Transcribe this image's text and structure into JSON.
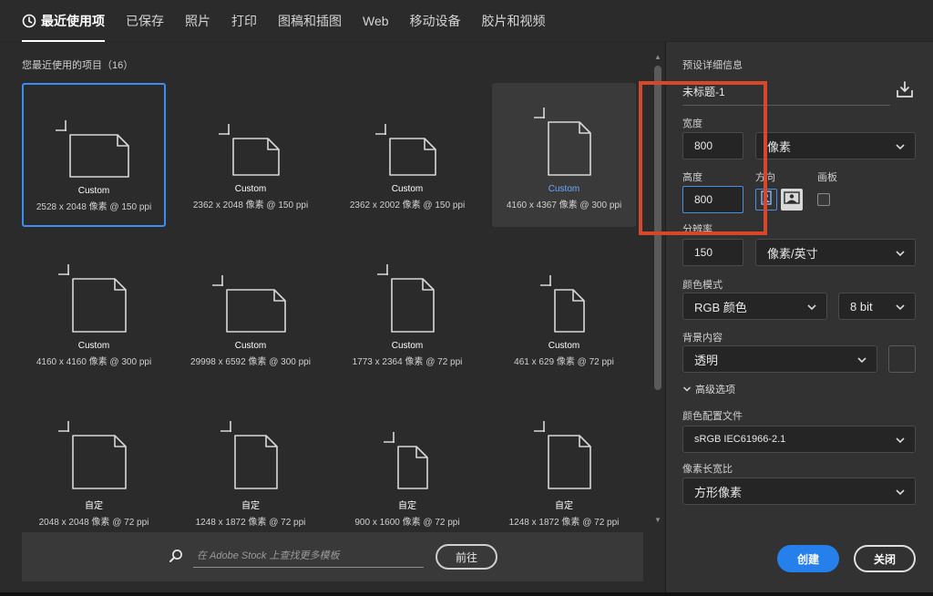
{
  "tabs": [
    {
      "label": "最近使用项",
      "active": true
    },
    {
      "label": "已保存"
    },
    {
      "label": "照片"
    },
    {
      "label": "打印"
    },
    {
      "label": "图稿和插图"
    },
    {
      "label": "Web"
    },
    {
      "label": "移动设备"
    },
    {
      "label": "胶片和视频"
    }
  ],
  "recent": {
    "title": "您最近使用的项目（16）",
    "items": [
      {
        "name": "Custom",
        "meta": "2528 x 2048 像素 @ 150 ppi",
        "orientation": "landscape",
        "selected": true
      },
      {
        "name": "Custom",
        "meta": "2362 x 2048 像素 @ 150 ppi",
        "orientation": "landscape-small"
      },
      {
        "name": "Custom",
        "meta": "2362 x 2002 像素 @ 150 ppi",
        "orientation": "landscape-small"
      },
      {
        "name": "Custom",
        "meta": "4160 x 4367 像素 @ 300 ppi",
        "orientation": "portrait",
        "hover": true
      },
      {
        "name": "Custom",
        "meta": "4160 x 4160 像素 @ 300 ppi",
        "orientation": "square"
      },
      {
        "name": "Custom",
        "meta": "29998 x 6592 像素 @ 300 ppi",
        "orientation": "landscape"
      },
      {
        "name": "Custom",
        "meta": "1773 x 2364 像素 @ 72 ppi",
        "orientation": "portrait"
      },
      {
        "name": "Custom",
        "meta": "461 x 629 像素 @ 72 ppi",
        "orientation": "portrait-small"
      },
      {
        "name": "自定",
        "meta": "2048 x 2048 像素 @ 72 ppi",
        "orientation": "square"
      },
      {
        "name": "自定",
        "meta": "1248 x 1872 像素 @ 72 ppi",
        "orientation": "portrait"
      },
      {
        "name": "自定",
        "meta": "900 x 1600 像素 @ 72 ppi",
        "orientation": "portrait-small"
      },
      {
        "name": "自定",
        "meta": "1248 x 1872 像素 @ 72 ppi",
        "orientation": "portrait"
      }
    ]
  },
  "search": {
    "placeholder": "在 Adobe Stock 上查找更多模板",
    "go_label": "前往"
  },
  "preset": {
    "section_label": "预设详细信息",
    "doc_name": "未标题-1",
    "width_label": "宽度",
    "width_value": "800",
    "width_unit": "像素",
    "height_label": "高度",
    "height_value": "800",
    "orientation_label": "方向",
    "artboard_label": "画板",
    "resolution_label": "分辨率",
    "resolution_value": "150",
    "resolution_unit": "像素/英寸",
    "color_mode_label": "颜色模式",
    "color_mode_value": "RGB 颜色",
    "bit_depth_value": "8 bit",
    "background_label": "背景内容",
    "background_value": "透明",
    "advanced_label": "高级选项",
    "color_profile_label": "颜色配置文件",
    "color_profile_value": "sRGB IEC61966-2.1",
    "pixel_aspect_label": "像素长宽比",
    "pixel_aspect_value": "方形像素"
  },
  "actions": {
    "create_label": "创建",
    "close_label": "关闭"
  },
  "colors": {
    "accent": "#2680eb",
    "selection": "#3f8cf0",
    "highlight_box": "#d9472b"
  }
}
